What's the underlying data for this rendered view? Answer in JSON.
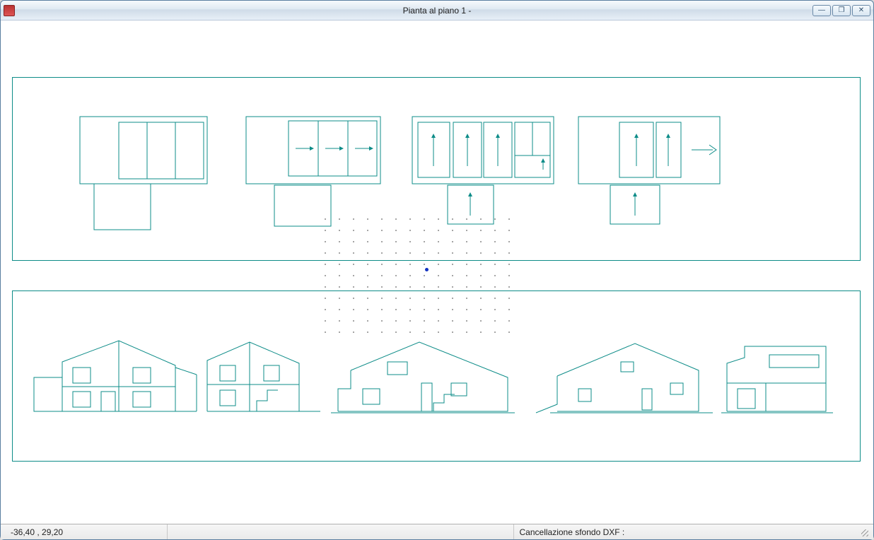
{
  "window": {
    "title": "Pianta al piano 1 -",
    "app_icon_name": "brick-icon"
  },
  "win_controls": {
    "minimize_glyph": "—",
    "maximize_glyph": "❐",
    "close_glyph": "✕"
  },
  "statusbar": {
    "coords": "-36,40 , 29,20",
    "message": "Cancellazione sfondo DXF :"
  },
  "drawing": {
    "stroke_color": "#0d8c88",
    "panels": [
      "floorplans",
      "elevations"
    ]
  }
}
